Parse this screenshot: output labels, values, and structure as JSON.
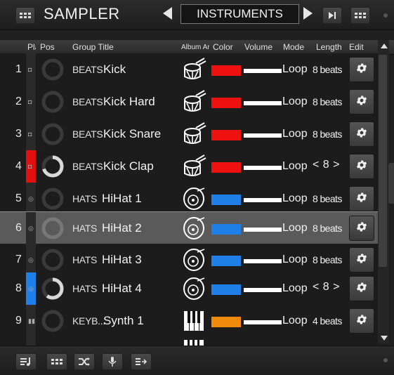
{
  "header": {
    "title": "SAMPLER",
    "bank": "INSTRUMENTS"
  },
  "columns": {
    "play": "Pla",
    "pos": "Pos",
    "group_title": "Group Title",
    "album_art": "Album Art",
    "color": "Color",
    "volume": "Volume",
    "mode": "Mode",
    "length": "Length",
    "edit": "Edit"
  },
  "rows": [
    {
      "num": "1",
      "group": "BEATS",
      "title": "Kick",
      "art": "drum-icon",
      "color": "#ef1010",
      "mode": "Loop",
      "length": "8 beats",
      "length_style": "text",
      "state": "idle",
      "progress": 0
    },
    {
      "num": "2",
      "group": "BEATS",
      "title": "Kick Hard",
      "art": "drum-icon",
      "color": "#ef1010",
      "mode": "Loop",
      "length": "8 beats",
      "length_style": "text",
      "state": "idle",
      "progress": 0
    },
    {
      "num": "3",
      "group": "BEATS",
      "title": "Kick Snare",
      "art": "drum-icon",
      "color": "#ef1010",
      "mode": "Loop",
      "length": "8 beats",
      "length_style": "text",
      "state": "idle",
      "progress": 0
    },
    {
      "num": "4",
      "group": "BEATS",
      "title": "Kick Clap",
      "art": "drum-icon",
      "color": "#ef1010",
      "mode": "Loop",
      "length": "< 8 >",
      "length_style": "box",
      "state": "playing-red",
      "progress": 0.7
    },
    {
      "num": "5",
      "group": "HATS",
      "title": "HiHat 1",
      "art": "cymbal-icon",
      "color": "#1e7fe8",
      "mode": "Loop",
      "length": "8 beats",
      "length_style": "text",
      "state": "idle",
      "progress": 0
    },
    {
      "num": "6",
      "group": "HATS",
      "title": "HiHat 2",
      "art": "cymbal-icon",
      "color": "#1e7fe8",
      "mode": "Loop",
      "length": "8 beats",
      "length_style": "text",
      "state": "selected",
      "progress": 0
    },
    {
      "num": "7",
      "group": "HATS",
      "title": "HiHat 3",
      "art": "cymbal-icon",
      "color": "#1e7fe8",
      "mode": "Loop",
      "length": "8 beats",
      "length_style": "text",
      "state": "idle",
      "progress": 0
    },
    {
      "num": "8",
      "group": "HATS",
      "title": "HiHat 4",
      "art": "cymbal-icon",
      "color": "#1e7fe8",
      "mode": "Loop",
      "length": "< 8 >",
      "length_style": "box",
      "state": "playing-blue",
      "progress": 0.6
    },
    {
      "num": "9",
      "group": "KEYB...",
      "title": "Synth 1",
      "art": "piano-icon",
      "color": "#f08a0c",
      "mode": "Loop",
      "length": "4 beats",
      "length_style": "text",
      "state": "idle",
      "progress": 0
    }
  ],
  "footer": {
    "buttons": [
      "playlist-icon",
      "grid-icon",
      "shuffle-icon",
      "mic-icon",
      "export-icon"
    ]
  }
}
